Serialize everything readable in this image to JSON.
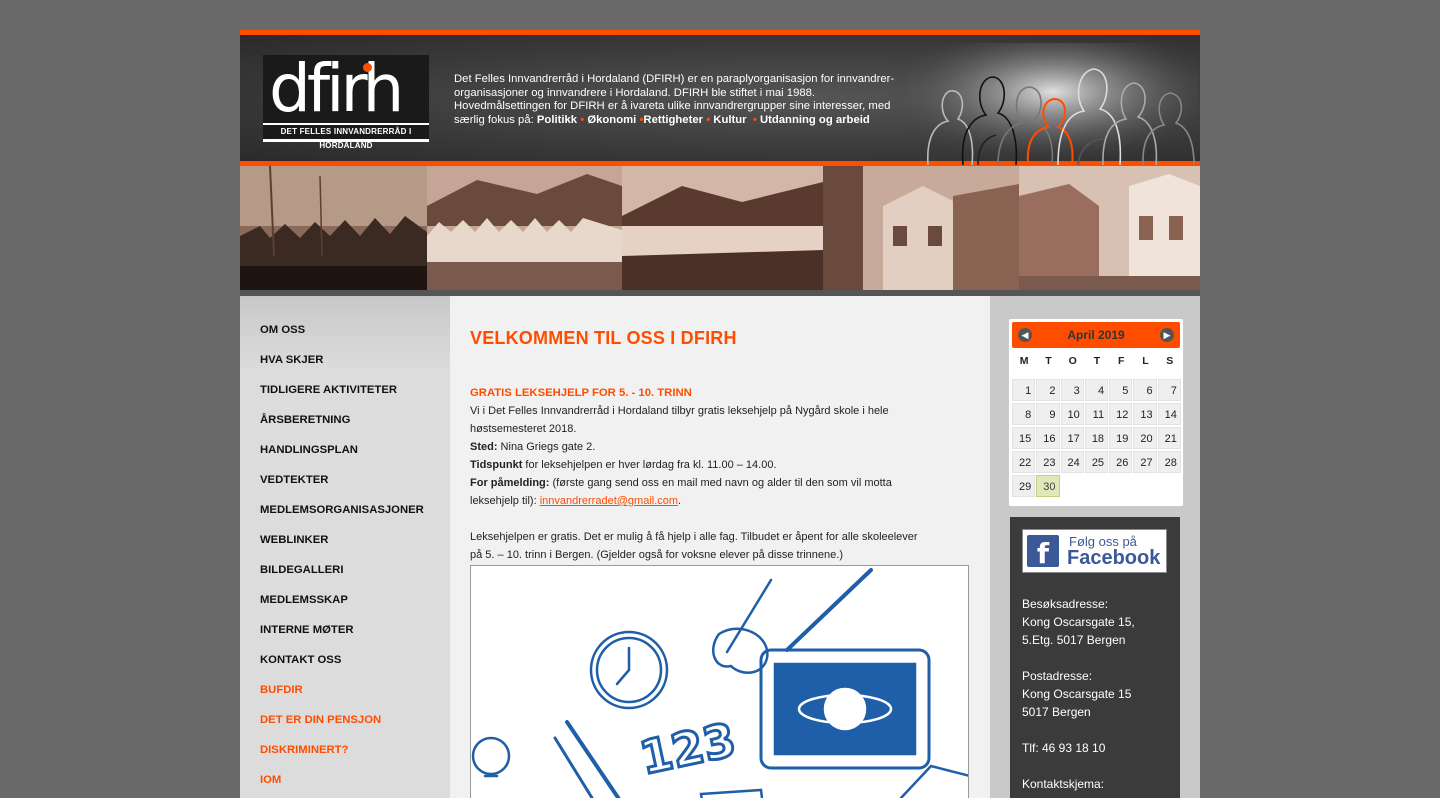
{
  "header": {
    "logo_text": "dfirh",
    "logo_subtitle": "DET FELLES INNVANDRERRÅD I HORDALAND",
    "intro_line1": "Det Felles Innvandrerråd i Hordaland (DFIRH) er en paraplyorganisasjon for innvandrer-",
    "intro_line2": "organisasjoner og innvandrere i Hordaland. DFIRH ble stiftet i mai 1988.",
    "intro_line3": "Hovedmålsettingen for DFIRH er å ivareta ulike innvandrergrupper sine interesser, med",
    "intro_line4_prefix": "særlig fokus på: ",
    "focus_areas": [
      "Politikk",
      "Økonomi",
      "Rettigheter",
      "Kultur",
      "Utdanning og arbeid"
    ]
  },
  "nav": {
    "items": [
      "OM OSS",
      "HVA SKJER",
      "TIDLIGERE AKTIVITETER",
      "ÅRSBERETNING",
      "HANDLINGSPLAN",
      "VEDTEKTER",
      "MEDLEMSORGANISASJONER",
      "WEBLINKER",
      "BILDEGALLERI",
      "MEDLEMSSKAP",
      "INTERNE MØTER",
      "KONTAKT OSS"
    ],
    "external_items": [
      "BUFDIR",
      "DET ER DIN PENSJON",
      "DISKRIMINERT?",
      "IOM"
    ]
  },
  "main": {
    "title": "VELKOMMEN TIL OSS I DFIRH",
    "section_title": "GRATIS LEKSEHJELP FOR 5. - 10. TRINN",
    "intro_line1": "Vi i Det Felles Innvandrerråd i Hordaland tilbyr gratis leksehjelp på Nygård skole i hele",
    "intro_line2": "høstsemesteret 2018.",
    "sted_label": "Sted:",
    "sted_value": " Nina Griegs gate 2.",
    "tid_label": "Tidspunkt",
    "tid_value": " for leksehjelpen er hver lørdag fra kl. 11.00 – 14.00.",
    "pamelding_label": "For påmelding:",
    "pamelding_value": " (første gang send oss en mail med navn og alder til den som vil motta",
    "pamelding_line2": "leksehjelp til): ",
    "email": "innvandrerradet@gmail.com",
    "pamelding_end": ".",
    "para2_line1": "Leksehjelpen er gratis. Det er mulig å få hjelp i alle fag. Tilbudet er åpent for alle skoleelever",
    "para2_line2": "på 5. – 10. trinn i Bergen. (Gjelder også for voksne elever på disse trinnene.)",
    "illustration_number": "123"
  },
  "calendar": {
    "title": "April 2019",
    "weekdays": [
      "M",
      "T",
      "O",
      "T",
      "F",
      "L",
      "S"
    ],
    "weeks": [
      [
        "1",
        "2",
        "3",
        "4",
        "5",
        "6",
        "7"
      ],
      [
        "8",
        "9",
        "10",
        "11",
        "12",
        "13",
        "14"
      ],
      [
        "15",
        "16",
        "17",
        "18",
        "19",
        "20",
        "21"
      ],
      [
        "22",
        "23",
        "24",
        "25",
        "26",
        "27",
        "28"
      ],
      [
        "29",
        "30",
        "",
        "",
        "",
        "",
        ""
      ]
    ],
    "today": "30"
  },
  "contact": {
    "fb_line1": "Følg oss på",
    "fb_line2": "Facebook",
    "visit_label": "Besøksadresse:",
    "visit_line1": "Kong Oscarsgate 15,",
    "visit_line2": "5.Etg. 5017 Bergen",
    "post_label": "Postadresse:",
    "post_line1": "Kong Oscarsgate 15",
    "post_line2": "5017 Bergen",
    "phone": "Tlf: 46 93 18 10",
    "form_label": "Kontaktskjema:"
  },
  "colors": {
    "accent": "#ff4d00",
    "background": "#6a6a6a",
    "nav_bg": "#dcdcdc",
    "content_bg": "#f1f1f1",
    "contact_bg": "#3b3b3b",
    "facebook": "#3b5998"
  }
}
